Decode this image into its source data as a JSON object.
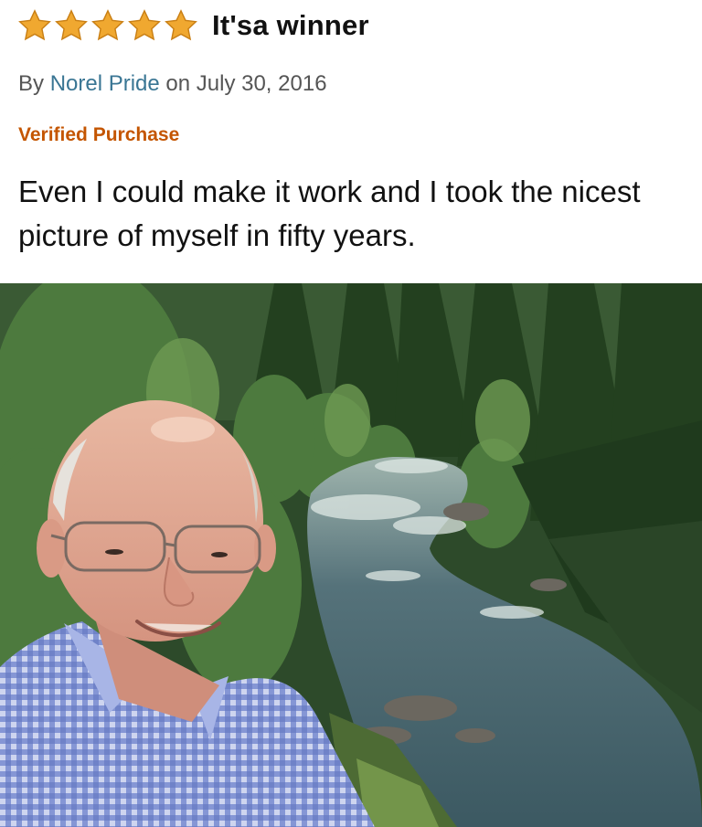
{
  "review": {
    "rating": 5,
    "rating_max": 5,
    "star_color": "#f0a830",
    "title": "It'sa winner",
    "by_prefix": "By ",
    "author": "Norel Pride",
    "date_text": " on July 30, 2016",
    "verified_label": "Verified Purchase",
    "body": "Even I could make it work and I took the nicest picture of myself in fifty years."
  },
  "photo": {
    "subject": "selfie-river-forest"
  }
}
